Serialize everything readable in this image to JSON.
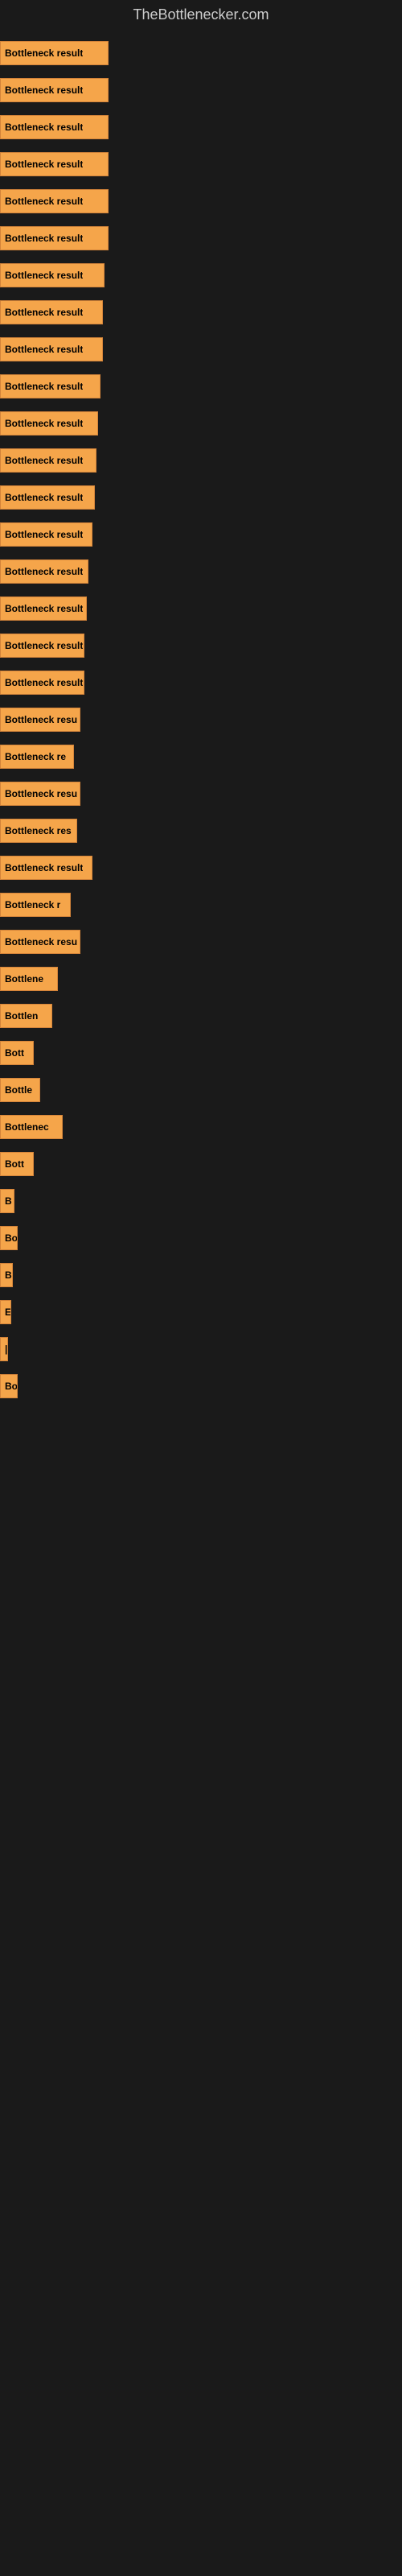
{
  "site": {
    "title": "TheBottlenecker.com"
  },
  "bars": [
    {
      "label": "Bottleneck result",
      "width": 135
    },
    {
      "label": "Bottleneck result",
      "width": 135
    },
    {
      "label": "Bottleneck result",
      "width": 135
    },
    {
      "label": "Bottleneck result",
      "width": 135
    },
    {
      "label": "Bottleneck result",
      "width": 135
    },
    {
      "label": "Bottleneck result",
      "width": 135
    },
    {
      "label": "Bottleneck result",
      "width": 130
    },
    {
      "label": "Bottleneck result",
      "width": 128
    },
    {
      "label": "Bottleneck result",
      "width": 128
    },
    {
      "label": "Bottleneck result",
      "width": 125
    },
    {
      "label": "Bottleneck result",
      "width": 122
    },
    {
      "label": "Bottleneck result",
      "width": 120
    },
    {
      "label": "Bottleneck result",
      "width": 118
    },
    {
      "label": "Bottleneck result",
      "width": 115
    },
    {
      "label": "Bottleneck result",
      "width": 110
    },
    {
      "label": "Bottleneck result",
      "width": 108
    },
    {
      "label": "Bottleneck result",
      "width": 105
    },
    {
      "label": "Bottleneck result",
      "width": 105
    },
    {
      "label": "Bottleneck resu",
      "width": 100
    },
    {
      "label": "Bottleneck re",
      "width": 92
    },
    {
      "label": "Bottleneck resu",
      "width": 100
    },
    {
      "label": "Bottleneck res",
      "width": 96
    },
    {
      "label": "Bottleneck result",
      "width": 115
    },
    {
      "label": "Bottleneck r",
      "width": 88
    },
    {
      "label": "Bottleneck resu",
      "width": 100
    },
    {
      "label": "Bottlene",
      "width": 72
    },
    {
      "label": "Bottlen",
      "width": 65
    },
    {
      "label": "Bott",
      "width": 42
    },
    {
      "label": "Bottle",
      "width": 50
    },
    {
      "label": "Bottlenec",
      "width": 78
    },
    {
      "label": "Bott",
      "width": 42
    },
    {
      "label": "B",
      "width": 18
    },
    {
      "label": "Bo",
      "width": 22
    },
    {
      "label": "B",
      "width": 16
    },
    {
      "label": "E",
      "width": 14
    },
    {
      "label": "|",
      "width": 10
    },
    {
      "label": "Bo",
      "width": 22
    }
  ]
}
